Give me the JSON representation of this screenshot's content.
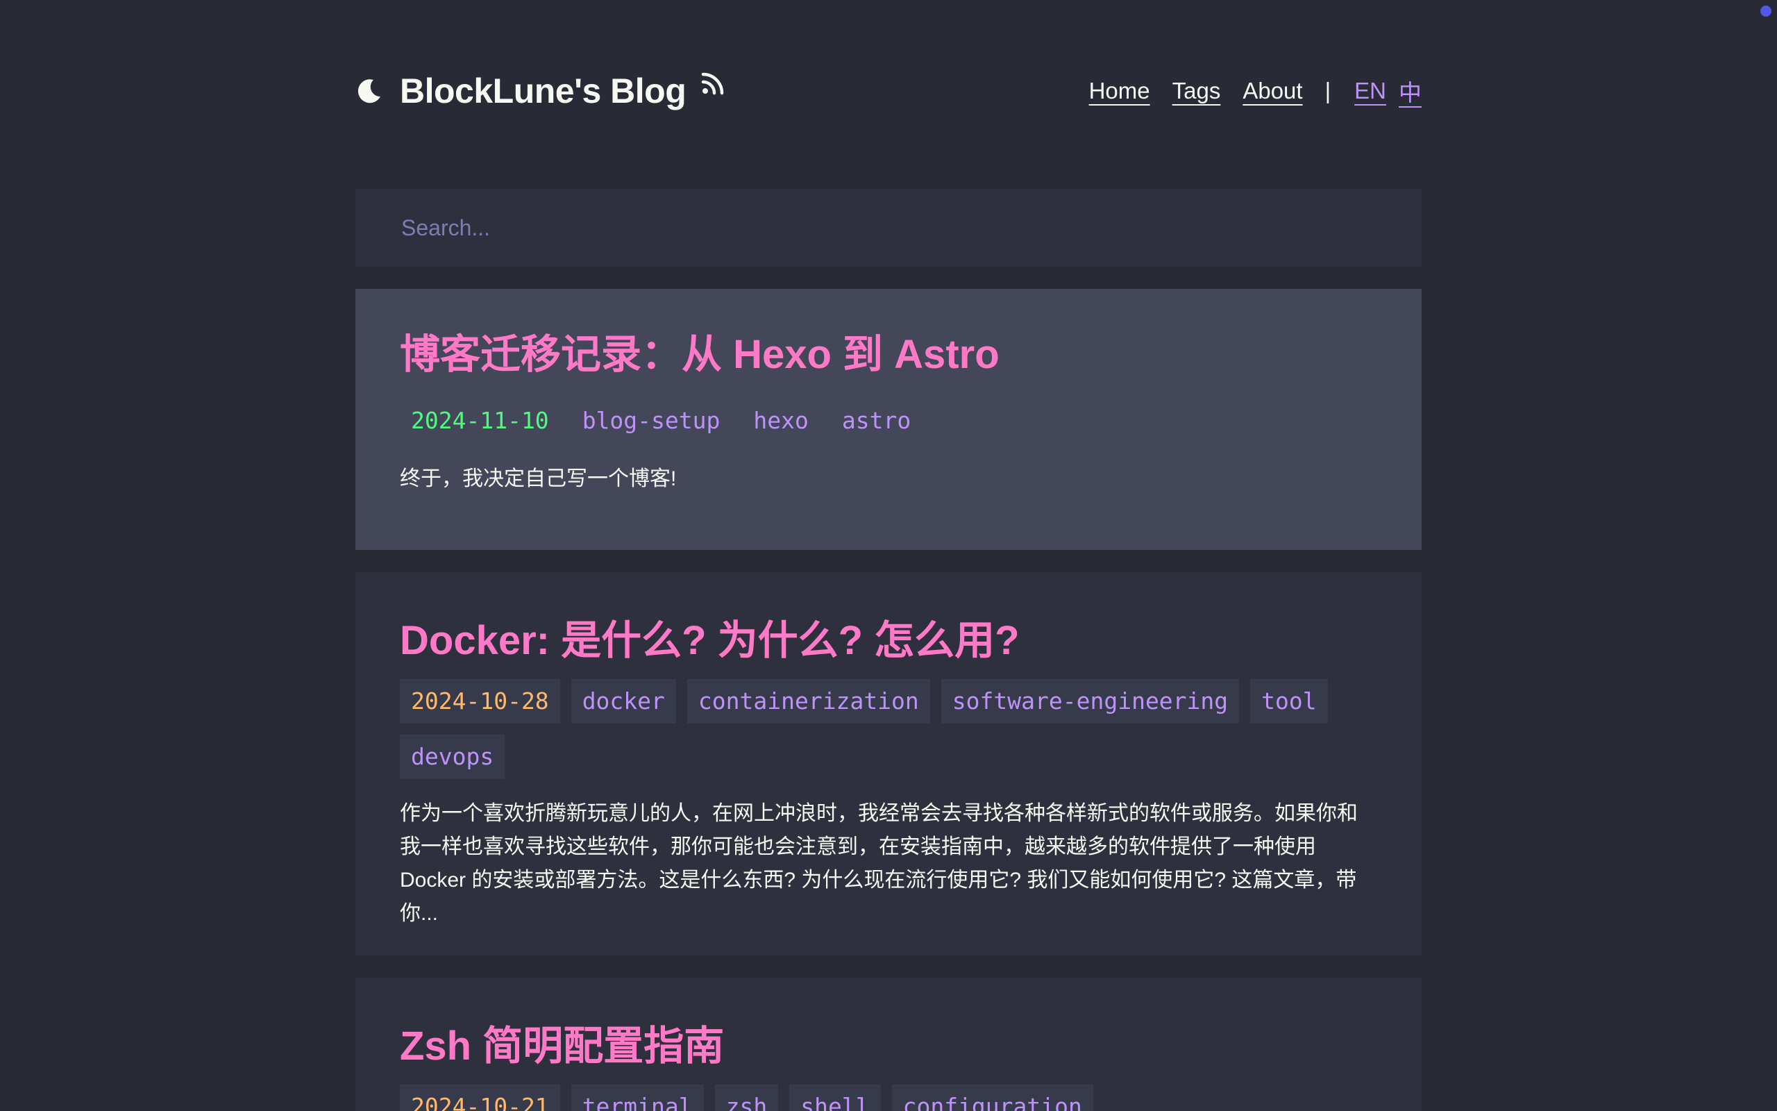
{
  "header": {
    "title": "BlockLune's Blog",
    "nav": {
      "home": "Home",
      "tags": "Tags",
      "about": "About",
      "separator": "|",
      "lang_en": "EN",
      "lang_zh": "中"
    }
  },
  "search": {
    "placeholder": "Search..."
  },
  "posts": [
    {
      "title": "博客迁移记录：从 Hexo 到 Astro",
      "date": "2024-11-10",
      "tags": [
        "blog-setup",
        "hexo",
        "astro"
      ],
      "excerpt": "终于，我决定自己写一个博客!"
    },
    {
      "title": "Docker: 是什么? 为什么? 怎么用?",
      "date": "2024-10-28",
      "tags": [
        "docker",
        "containerization",
        "software-engineering",
        "tool",
        "devops"
      ],
      "excerpt": "作为一个喜欢折腾新玩意儿的人，在网上冲浪时，我经常会去寻找各种各样新式的软件或服务。如果你和我一样也喜欢寻找这些软件，那你可能也会注意到，在安装指南中，越来越多的软件提供了一种使用 Docker 的安装或部署方法。这是什么东西? 为什么现在流行使用它? 我们又能如何使用它? 这篇文章，带你..."
    },
    {
      "title": "Zsh 简明配置指南",
      "date": "2024-10-21",
      "tags": [
        "terminal",
        "zsh",
        "shell",
        "configuration"
      ]
    }
  ],
  "colors": {
    "background": "#282a36",
    "card": "#2e303e",
    "card_active": "#44475a",
    "title_pink": "#ff79c6",
    "tag_purple": "#bd93f9",
    "date_green": "#50fa7b",
    "date_orange": "#ffb86c",
    "corner_dot": "#5b55e6"
  }
}
